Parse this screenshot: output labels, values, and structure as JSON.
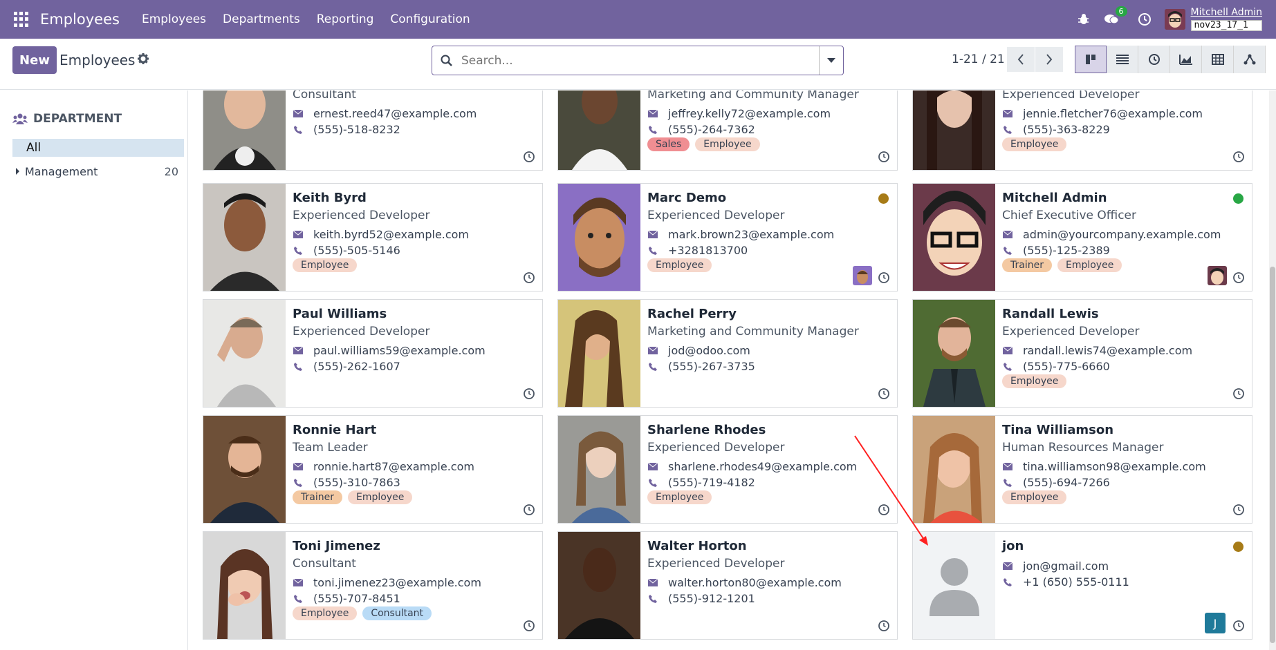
{
  "navbar": {
    "brand": "Employees",
    "menu": [
      "Employees",
      "Departments",
      "Reporting",
      "Configuration"
    ],
    "message_count": "6",
    "user_name": "Mitchell Admin",
    "db_name": "nov23_17_1"
  },
  "control": {
    "new_label": "New",
    "breadcrumb": "Employees",
    "search_placeholder": "Search...",
    "pager": "1-21 / 21"
  },
  "sidebar": {
    "header": "DEPARTMENT",
    "all_label": "All",
    "items": [
      {
        "label": "Management",
        "count": "20"
      }
    ]
  },
  "cards": [
    {
      "job": "Consultant",
      "email": "ernest.reed47@example.com",
      "phone": "(555)-518-8232"
    },
    {
      "job": "Marketing and Community Manager",
      "email": "jeffrey.kelly72@example.com",
      "phone": "(555)-264-7362",
      "tags": [
        "Sales",
        "Employee"
      ]
    },
    {
      "job": "Experienced Developer",
      "email": "jennie.fletcher76@example.com",
      "phone": "(555)-363-8229",
      "tags": [
        "Employee"
      ]
    },
    {
      "name": "Keith Byrd",
      "job": "Experienced Developer",
      "email": "keith.byrd52@example.com",
      "phone": "(555)-505-5146",
      "tags": [
        "Employee"
      ]
    },
    {
      "name": "Marc Demo",
      "job": "Experienced Developer",
      "email": "mark.brown23@example.com",
      "phone": "+3281813700",
      "tags": [
        "Employee"
      ],
      "status_color": "#a77b17"
    },
    {
      "name": "Mitchell Admin",
      "job": "Chief Executive Officer",
      "email": "admin@yourcompany.example.com",
      "phone": "(555)-125-2389",
      "tags": [
        "Trainer",
        "Employee"
      ],
      "status_color": "#28a745"
    },
    {
      "name": "Paul Williams",
      "job": "Experienced Developer",
      "email": "paul.williams59@example.com",
      "phone": "(555)-262-1607"
    },
    {
      "name": "Rachel Perry",
      "job": "Marketing and Community Manager",
      "email": "jod@odoo.com",
      "phone": "(555)-267-3735"
    },
    {
      "name": "Randall Lewis",
      "job": "Experienced Developer",
      "email": "randall.lewis74@example.com",
      "phone": "(555)-775-6660",
      "tags": [
        "Employee"
      ]
    },
    {
      "name": "Ronnie Hart",
      "job": "Team Leader",
      "email": "ronnie.hart87@example.com",
      "phone": "(555)-310-7863",
      "tags": [
        "Trainer",
        "Employee"
      ]
    },
    {
      "name": "Sharlene Rhodes",
      "job": "Experienced Developer",
      "email": "sharlene.rhodes49@example.com",
      "phone": "(555)-719-4182",
      "tags": [
        "Employee"
      ]
    },
    {
      "name": "Tina Williamson",
      "job": "Human Resources Manager",
      "email": "tina.williamson98@example.com",
      "phone": "(555)-694-7266",
      "tags": [
        "Employee"
      ]
    },
    {
      "name": "Toni Jimenez",
      "job": "Consultant",
      "email": "toni.jimenez23@example.com",
      "phone": "(555)-707-8451",
      "tags": [
        "Employee",
        "Consultant"
      ]
    },
    {
      "name": "Walter Horton",
      "job": "Experienced Developer",
      "email": "walter.horton80@example.com",
      "phone": "(555)-912-1201"
    },
    {
      "name": "jon",
      "email": "jon@gmail.com",
      "phone": "+1 (650) 555-0111",
      "status_color": "#a77b17",
      "avatar_letter": "J"
    }
  ],
  "colors": {
    "brand": "#71639e",
    "employee_tag": "#f6d7cb",
    "trainer_tag": "#f4c9a2",
    "sales_tag": "#f08e92",
    "consultant_tag": "#b9dbf6",
    "annotation_arrow": "#ff2020"
  }
}
